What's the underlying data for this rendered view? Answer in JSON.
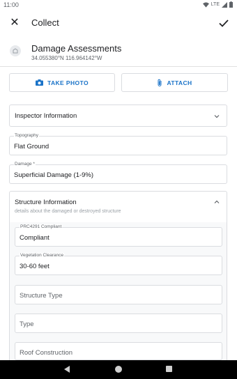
{
  "status_bar": {
    "time": "11:00",
    "network": "LTE"
  },
  "app_bar": {
    "title": "Collect"
  },
  "layer": {
    "title": "Damage Assessments",
    "coordinates": "34.055380°N  116.964142°W"
  },
  "actions": {
    "take_photo": "TAKE PHOTO",
    "attach": "ATTACH"
  },
  "inspector_section": {
    "title": "Inspector Information"
  },
  "fields": {
    "topography": {
      "label": "Topography",
      "value": "Flat Ground"
    },
    "damage": {
      "label": "Damage *",
      "value": "Superficial Damage (1-9%)"
    }
  },
  "structure_section": {
    "title": "Structure Information",
    "description": "details about the damaged or destroyed structure",
    "fields": {
      "prc4291": {
        "label": "PRC4291 Compliant",
        "value": "Compliant"
      },
      "vegetation": {
        "label": "Vegetation Clearance",
        "value": "30-60 feet"
      },
      "structure_type": {
        "placeholder": "Structure Type"
      },
      "type": {
        "placeholder": "Type"
      },
      "roof": {
        "placeholder": "Roof Construction"
      }
    }
  },
  "colors": {
    "accent": "#1a73c8",
    "border": "#dadce0",
    "nav_bar": "#000000"
  }
}
